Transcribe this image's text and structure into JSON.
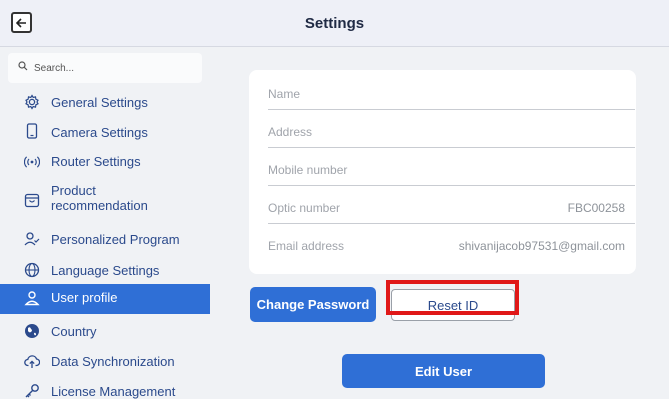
{
  "header": {
    "title": "Settings"
  },
  "search": {
    "placeholder": "Search..."
  },
  "sidebar": {
    "items": [
      {
        "label": "General Settings",
        "icon": "gear-icon"
      },
      {
        "label": "Camera Settings",
        "icon": "phone-icon"
      },
      {
        "label": "Router Settings",
        "icon": "wifi-signal-icon"
      },
      {
        "label_line1": "Product",
        "label_line2": "recommendation",
        "icon": "box-icon"
      },
      {
        "label": "Personalized Program",
        "icon": "user-check-icon"
      },
      {
        "label": "Language Settings",
        "icon": "globe-icon"
      },
      {
        "label": "User profile",
        "icon": "user-icon",
        "active": true
      },
      {
        "label": "Country",
        "icon": "country-globe-icon"
      },
      {
        "label": "Data Synchronization",
        "icon": "cloud-sync-icon"
      },
      {
        "label": "License Management",
        "icon": "key-icon"
      }
    ]
  },
  "profile": {
    "fields": [
      {
        "label": "Name",
        "value": ""
      },
      {
        "label": "Address",
        "value": ""
      },
      {
        "label": "Mobile number",
        "value": ""
      },
      {
        "label": "Optic number",
        "value": "FBC00258"
      },
      {
        "label": "Email address",
        "value": "shivanijacob97531@gmail.com"
      }
    ]
  },
  "actions": {
    "change_password": "Change Password",
    "reset_id": "Reset ID",
    "edit_user": "Edit User"
  },
  "colors": {
    "accent": "#2f6fd6",
    "highlight": "#e01818",
    "nav_text": "#2b4a8c"
  }
}
